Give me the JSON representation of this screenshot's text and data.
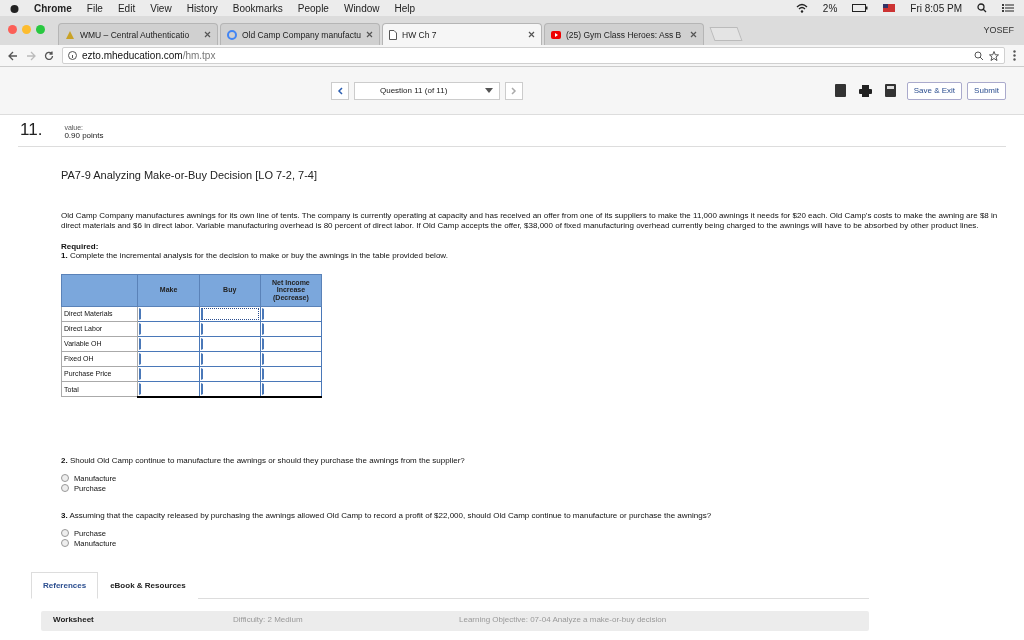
{
  "menu_bar": {
    "app": "Chrome",
    "items": [
      "File",
      "Edit",
      "View",
      "History",
      "Bookmarks",
      "People",
      "Window",
      "Help"
    ],
    "battery": "2%",
    "clock": "Fri 8:05 PM"
  },
  "browser_tabs": [
    {
      "label": "WMU – Central Authenticatio",
      "selected": false
    },
    {
      "label": "Old Camp Company manufactu",
      "selected": false
    },
    {
      "label": "HW Ch 7",
      "selected": true
    },
    {
      "label": "(25) Gym Class Heroes: Ass B",
      "selected": false
    }
  ],
  "profile": "YOSEF",
  "address": {
    "domain": "ezto.mheducation.com",
    "path": "/hm.tpx"
  },
  "toolbar": {
    "question_select": "Question 11 (of 11)",
    "buttons": [
      "Save & Exit",
      "Submit"
    ]
  },
  "question": {
    "number": "11.",
    "value_label": "value:",
    "points": "0.90 points",
    "title": "PA7-9 Analyzing Make-or-Buy Decision [LO 7-2, 7-4]",
    "paragraph": "Old Camp Company manufactures awnings for its own line of tents. The company is currently operating at capacity and has received an offer from one of its suppliers to make the 11,000 awnings it needs for $20 each. Old Camp's costs to make the awning are $8 in direct materials and $6 in direct labor. Variable manufacturing overhead is 80 percent of direct labor. If Old Camp accepts the offer, $38,000 of fixed manufacturing overhead currently being charged to the awnings will have to be absorbed by other product lines.",
    "required_label": "Required:",
    "part_1": "**1.** Complete the incremental analysis for the decision to make or buy the awnings in the table provided below."
  },
  "table": {
    "columns": [
      "Make",
      "Buy",
      "Net Income Increase (Decrease)"
    ],
    "rows": [
      {
        "label": "Direct Materials",
        "kind": "line",
        "focused": [
          false,
          true,
          false
        ]
      },
      {
        "label": "Direct Labor",
        "kind": "line",
        "focused": [
          false,
          false,
          false
        ]
      },
      {
        "label": "Variable OH",
        "kind": "line",
        "focused": [
          false,
          false,
          false
        ]
      },
      {
        "label": "Fixed OH",
        "kind": "line",
        "focused": [
          false,
          false,
          false
        ]
      },
      {
        "label": "Purchase Price",
        "kind": "line",
        "focused": [
          false,
          false,
          false
        ]
      },
      {
        "label": "Total",
        "kind": "total",
        "focused": [
          false,
          false,
          false
        ]
      }
    ]
  },
  "parts": [
    {
      "prompt": "**2.** Should Old Camp continue to manufacture the awnings or should they purchase the awnings from the supplier?",
      "options": [
        {
          "label": "Manufacture",
          "selected": false
        },
        {
          "label": "Purchase",
          "selected": false
        }
      ]
    },
    {
      "prompt": "**3.** Assuming that the capacity released by purchasing the awnings allowed Old Camp to record a profit of $22,000, should Old Camp continue to manufacture or purchase the awnings?",
      "options": [
        {
          "label": "Purchase",
          "selected": false
        },
        {
          "label": "Manufacture",
          "selected": false
        }
      ]
    }
  ],
  "reference_tabs": [
    {
      "label": "References",
      "selected": true
    },
    {
      "label": "eBook & Resources",
      "selected": false
    }
  ],
  "reference_strip": {
    "worksheet": "Worksheet",
    "difficulty": "Difficulty: 2 Medium",
    "objective": "Learning Objective: 07-04 Analyze a make-or-buy decision"
  }
}
